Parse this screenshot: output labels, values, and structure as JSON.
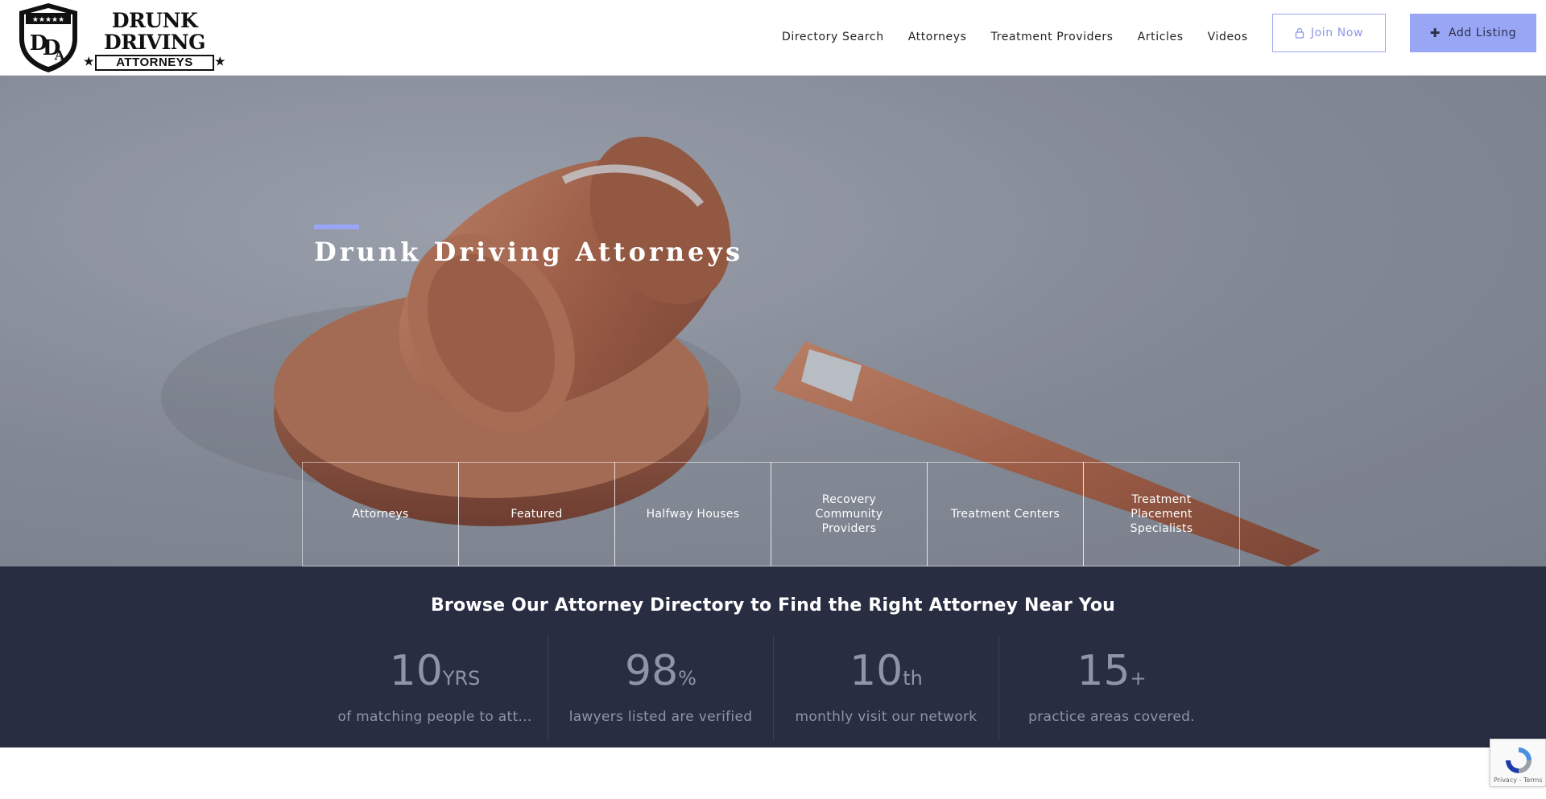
{
  "header": {
    "logo": {
      "line1": "DRUNK",
      "line2": "DRIVING",
      "line3": "ATTORNEYS",
      "monogram": "DDA"
    },
    "nav": [
      "Directory Search",
      "Attorneys",
      "Treatment Providers",
      "Articles",
      "Videos"
    ],
    "join_label": "Join Now",
    "add_label": "Add Listing",
    "icons": {
      "join": "lock-icon",
      "add": "plus-icon"
    },
    "accent_color": "#98a6f5"
  },
  "hero": {
    "title": "Drunk Driving Attorneys",
    "categories": [
      "Attorneys",
      "Featured",
      "Halfway Houses",
      "Recovery Community Providers",
      "Treatment Centers",
      "Treatment Placement Specialists"
    ]
  },
  "stats_band": {
    "title": "Browse Our Attorney Directory to Find the Right Attorney Near You",
    "stats": [
      {
        "value": "10",
        "suffix": "YRS",
        "label": "of matching people to att..."
      },
      {
        "value": "98",
        "suffix": "%",
        "label": "lawyers listed are verified"
      },
      {
        "value": "10",
        "suffix": "th",
        "label": "monthly visit our network"
      },
      {
        "value": "15",
        "suffix": "+",
        "label": "practice areas covered."
      }
    ],
    "background_color": "#282d42"
  },
  "recaptcha": {
    "label": "Privacy - Terms"
  }
}
